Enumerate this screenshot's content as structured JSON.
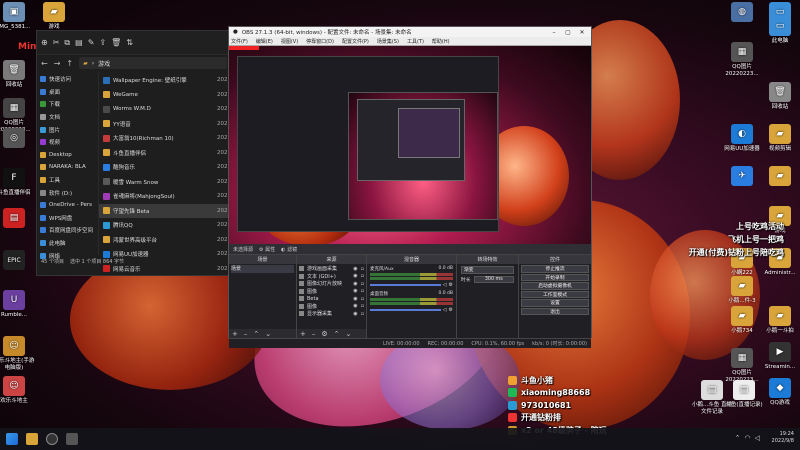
{
  "watermark": "MingRuoLiu521",
  "desktop_left": [
    {
      "label": "IMG_5381...",
      "color": "#6b8fb5",
      "glyph": "▣"
    },
    {
      "label": "回收站",
      "color": "#7a7a7a",
      "glyph": "🗑"
    },
    {
      "label": "QQ图片20220223...",
      "color": "#444",
      "glyph": "▦"
    },
    {
      "label": "",
      "color": "#555",
      "glyph": "◎"
    },
    {
      "label": "斗鱼直播伴侣",
      "color": "#111",
      "glyph": "F"
    },
    {
      "label": "",
      "color": "#c22",
      "glyph": "▤"
    },
    {
      "label": "",
      "color": "#222",
      "glyph": "EPIC"
    },
    {
      "label": "Rumble...",
      "color": "#6b3fa0",
      "glyph": "U"
    },
    {
      "label": "欢乐斗地主(手游电脑版)",
      "color": "#c78a2a",
      "glyph": "☺"
    },
    {
      "label": "欢乐斗地主",
      "color": "#c44",
      "glyph": "☺"
    }
  ],
  "desktop_top_folder": "游戏",
  "desktop_right": [
    {
      "label": "",
      "color": "#4a6fa5",
      "glyph": "◍"
    },
    {
      "label": "此电脑",
      "color": "#3a8ed8",
      "glyph": "▭"
    },
    {
      "label": "QQ图片20220223...",
      "color": "#555",
      "glyph": "▦"
    },
    {
      "label": "回收站",
      "color": "#888",
      "glyph": "🗑"
    },
    {
      "label": "网易UU加速器",
      "color": "#1b7bd6",
      "glyph": "◐"
    },
    {
      "label": "视频剪辑",
      "color": "#d9a53a",
      "glyph": "▰"
    },
    {
      "label": "",
      "color": "#2a7de1",
      "glyph": "✈"
    },
    {
      "label": "",
      "color": "#d9a53a",
      "glyph": "▰"
    },
    {
      "label": "游戏",
      "color": "#d9a53a",
      "glyph": "▰"
    },
    {
      "label": "小蜗222",
      "color": "#d9a53a",
      "glyph": "▰"
    },
    {
      "label": "小鹅...件-3",
      "color": "#d9a53a",
      "glyph": "▰"
    },
    {
      "label": "Administr...",
      "color": "#d9a53a",
      "glyph": "▰"
    },
    {
      "label": "小鹅734",
      "color": "#d9a53a",
      "glyph": "▰"
    },
    {
      "label": "小鹅一斗拍",
      "color": "#d9a53a",
      "glyph": "▰"
    },
    {
      "label": "此电脑",
      "color": "#3a8ed8",
      "glyph": "▭"
    },
    {
      "label": "QQ图片20220223...",
      "color": "#555",
      "glyph": "▦"
    },
    {
      "label": "Streamin...",
      "color": "#333",
      "glyph": "▶"
    },
    {
      "label": "QQ游戏",
      "color": "#1b7bd6",
      "glyph": "◆"
    },
    {
      "label": "小鹅...斗鱼 直播文件记录",
      "color": "#ddd",
      "glyph": "▤"
    },
    {
      "label": "斗鱼(直播记录)",
      "color": "#eee",
      "glyph": "▤"
    }
  ],
  "explorer": {
    "path": "游戏",
    "sidebar": [
      {
        "label": "快速访问",
        "color": "#3a7bd5"
      },
      {
        "label": "桌面",
        "color": "#3a7bd5"
      },
      {
        "label": "下载",
        "color": "#3a9a3a"
      },
      {
        "label": "文档",
        "color": "#999"
      },
      {
        "label": "图片",
        "color": "#3a9ad5"
      },
      {
        "label": "视频",
        "color": "#9a3ad5"
      },
      {
        "label": "Desktop",
        "color": "#d9a53a"
      },
      {
        "label": "NARAKA: BLA",
        "color": "#d9a53a"
      },
      {
        "label": "工具",
        "color": "#d9a53a"
      },
      {
        "label": "软件 (D:)",
        "color": "#888"
      },
      {
        "label": "OneDrive - Pers",
        "color": "#3a7bd5"
      },
      {
        "label": "WPS网盘",
        "color": "#3a7bd5"
      },
      {
        "label": "百度网盘同步空间",
        "color": "#3a7bd5"
      },
      {
        "label": "此电脑",
        "color": "#3a8ed8"
      },
      {
        "label": "网络",
        "color": "#3a8ed8"
      }
    ],
    "files": [
      {
        "name": "Wallpaper Engine: 壁纸引擎",
        "date": "2021",
        "color": "#2a6fb5"
      },
      {
        "name": "WeGame",
        "date": "2021",
        "color": "#d9a53a"
      },
      {
        "name": "Worms W.M.D",
        "date": "2021",
        "color": "#4a4a4a"
      },
      {
        "name": "YY语音",
        "date": "2021",
        "color": "#d9a53a"
      },
      {
        "name": "大富翁10(Richman 10)",
        "date": "2021",
        "color": "#c23a3a"
      },
      {
        "name": "斗鱼直播伴侣",
        "date": "2021",
        "color": "#d9a53a"
      },
      {
        "name": "酷狗音乐",
        "date": "2021",
        "color": "#2a7de1"
      },
      {
        "name": "暖雪 Warm Snow",
        "date": "2021",
        "color": "#5a5a5a"
      },
      {
        "name": "雀魂麻将(MahjongSoul)",
        "date": "2021",
        "color": "#a03ab5"
      },
      {
        "name": "守望先锋 Beta",
        "date": "2021",
        "color": "#d9a53a"
      },
      {
        "name": "腾讯QQ",
        "date": "2021",
        "color": "#2a9ad5"
      },
      {
        "name": "鸿蒙世界高级平台",
        "date": "2021",
        "color": "#d9a53a"
      },
      {
        "name": "网易UU加速器",
        "date": "2021",
        "color": "#1b7bd6"
      },
      {
        "name": "网易云音乐",
        "date": "2021",
        "color": "#c22"
      }
    ],
    "selected_index": 9,
    "status_count": "45 个项目",
    "status_selected": "选中 1 个项目 864 字节"
  },
  "obs": {
    "title": "OBS 27.1.3 (64-bit, windows) - 配置文件: 未命名 - 场景集: 未命名",
    "menu": [
      "文件(F)",
      "编辑(E)",
      "视图(V)",
      "停靠窗口(D)",
      "配置文件(P)",
      "场景集(S)",
      "工具(T)",
      "帮助(H)"
    ],
    "scene_bar_label": "未选择源",
    "scene_bar_props": "属性",
    "scene_bar_filters": "滤镜",
    "docks": {
      "scenes": {
        "title": "场景",
        "items": [
          "场景"
        ]
      },
      "sources": {
        "title": "来源",
        "items": [
          "游戏画面采集",
          "文本 (GDI+)",
          "图像幻灯片放映",
          "图像",
          "Beta",
          "图像",
          "显示器采集"
        ]
      },
      "mixer": {
        "title": "混音器",
        "channels": [
          {
            "name": "麦克风/Aux",
            "db": "0.0 dB"
          },
          {
            "name": "桌面音频",
            "db": "0.0 dB"
          }
        ]
      },
      "transitions": {
        "title": "转场特效",
        "type": "渐变",
        "duration_label": "时长",
        "duration_value": "300 ms"
      },
      "controls": {
        "title": "控件",
        "buttons": [
          "停止推流",
          "开始录制",
          "启动虚拟摄像机",
          "工作室模式",
          "设置",
          "退出"
        ]
      }
    },
    "status": {
      "live": "LIVE: 00:00:00",
      "rec": "REC: 00:00:00",
      "cpu": "CPU: 0.1%, 60.00 fps",
      "kbps": "kb/s: 0 (时长: 0:00:00)"
    }
  },
  "promo_lines": [
    "上号吃鸡活动",
    "飞机上号一把鸡",
    "开通(付费)钻粉上号陪吃鸡"
  ],
  "contact_lines": [
    {
      "text": "斗鱼小猪",
      "color": "#f0a030"
    },
    {
      "text": "xiaoming88668",
      "color": "#1db954"
    },
    {
      "text": "973010681",
      "color": "#2a9ad5"
    },
    {
      "text": "开通钻粉排",
      "color": "#e33"
    },
    {
      "text": "x2 or 48级牌子 - 陪玩",
      "color": "#c93"
    }
  ],
  "taskbar": {
    "time": "19:24",
    "date": "2022/9/8"
  }
}
